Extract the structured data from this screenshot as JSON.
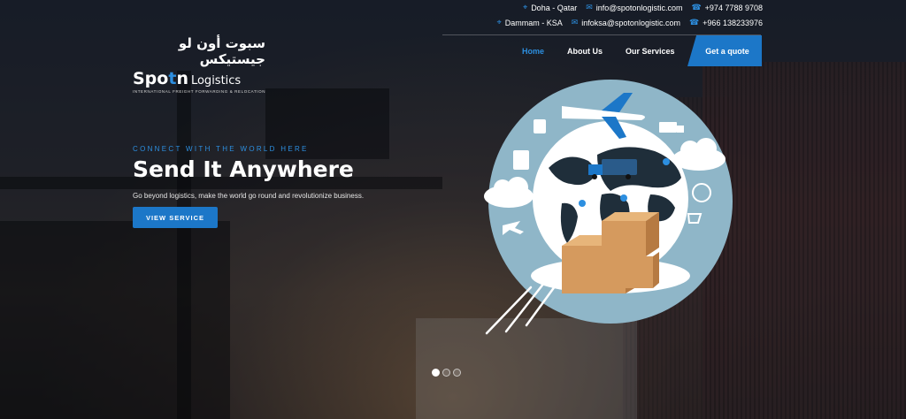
{
  "contacts": {
    "row1": {
      "location": "Doha - Qatar",
      "email": "info@spotonlogistic.com",
      "phone": "+974 7788 9708"
    },
    "row2": {
      "location": "Dammam - KSA",
      "email": "infoksa@spotonlogistic.com",
      "phone": "+966 138233976"
    }
  },
  "logo": {
    "arabic": "سبوت أون لو جيستيكس",
    "name_a": "Spo",
    "name_mid": "t",
    "name_b": "n",
    "name_c": "Logistics",
    "subtitle": "INTERNATIONAL FREIGHT FORWARDING & RELOCATION"
  },
  "nav": {
    "items": [
      {
        "label": "Home"
      },
      {
        "label": "About Us"
      },
      {
        "label": "Our Services"
      }
    ],
    "quote_label": "Get a quote"
  },
  "hero": {
    "tagline": "CONNECT WITH THE WORLD HERE",
    "headline": "Send It Anywhere",
    "subline": "Go beyond logistics, make the world go round and revolutionize business.",
    "cta_label": "VIEW SERVICE"
  },
  "colors": {
    "accent": "#1c77c8",
    "accent_text": "#2d8fe0",
    "globe_bg": "#8fb6c8",
    "continents": "#1f2e3a"
  },
  "slider": {
    "count": 3,
    "active": 1
  }
}
